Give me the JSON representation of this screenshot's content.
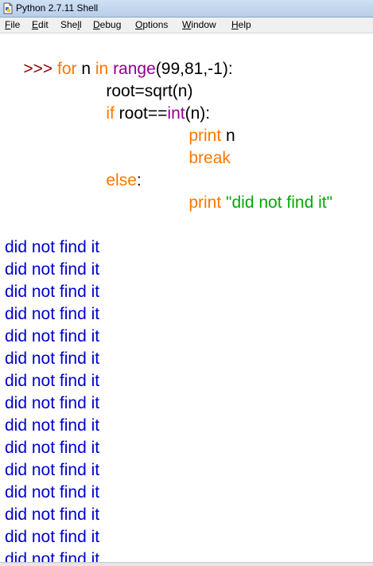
{
  "window": {
    "title": "Python 2.7.11 Shell"
  },
  "menu": {
    "items": [
      {
        "u": "F",
        "rest": "ile"
      },
      {
        "u": "E",
        "rest": "dit"
      },
      {
        "pre": "She",
        "u": "l",
        "rest": "l"
      },
      {
        "u": "D",
        "rest": "ebug"
      },
      {
        "u": "O",
        "rest": "ptions"
      },
      {
        "u": "W",
        "rest": "indow"
      },
      {
        "u": "H",
        "rest": "elp"
      }
    ]
  },
  "code": {
    "prompt": ">>>",
    "line1": {
      "kw_for": "for",
      "var_n": " n ",
      "kw_in": "in",
      "sp": " ",
      "fn_range": "range",
      "args": "(99,81,-1):"
    },
    "line2": {
      "text": "root=sqrt(n)"
    },
    "line3": {
      "kw_if": "if",
      "mid": " root==",
      "fn_int": "int",
      "args": "(n):"
    },
    "line4": {
      "kw_print": "print",
      "arg": " n"
    },
    "line5": {
      "kw_break": "break"
    },
    "line6": {
      "kw_else": "else",
      "colon": ":"
    },
    "line7": {
      "kw_print": "print",
      "sp": " ",
      "str": "\"did not find it\""
    }
  },
  "output": {
    "lines": [
      "did not find it",
      "did not find it",
      "did not find it",
      "did not find it",
      "did not find it",
      "did not find it",
      "did not find it",
      "did not find it",
      "did not find it",
      "did not find it",
      "did not find it",
      "did not find it",
      "did not find it",
      "did not find it",
      "did not find it"
    ]
  },
  "colors": {
    "keyword": "#ff7700",
    "builtin": "#900090",
    "string": "#00aa00",
    "output": "#0000cc",
    "prompt": "#990000"
  }
}
